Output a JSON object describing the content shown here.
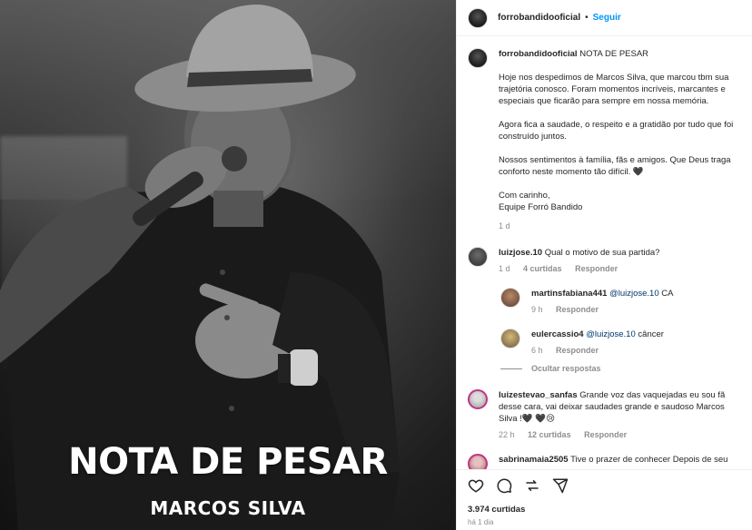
{
  "media": {
    "overlay_title": "NOTA DE PESAR",
    "overlay_subtitle": "MARCOS SILVA"
  },
  "header": {
    "username": "forrobandidooficial",
    "separator": "•",
    "follow_label": "Seguir"
  },
  "caption": {
    "username": "forrobandidooficial",
    "headline": "NOTA DE PESAR",
    "paragraphs": [
      "Hoje nos despedimos de Marcos Silva, que marcou tbm sua trajetória conosco. Foram momentos incríveis, marcantes e especiais que ficarão para sempre em nossa memória.",
      "Agora fica a saudade, o respeito e a gratidão por tudo que foi construído juntos.",
      "Nossos sentimentos à família, fãs e amigos. Que Deus traga conforto neste momento tão difícil. 🖤"
    ],
    "sign_line1": "Com carinho,",
    "sign_line2": "Equipe Forró Bandido",
    "time": "1 d"
  },
  "comments": [
    {
      "username": "luizjose.10",
      "text": "Qual o motivo de sua partida?",
      "time": "1 d",
      "likes": "4 curtidas",
      "reply_label": "Responder",
      "replies": [
        {
          "username": "martinsfabiana441",
          "mention": "@luizjose.10",
          "text": "CA",
          "time": "9 h",
          "reply_label": "Responder"
        },
        {
          "username": "eulercassio4",
          "mention": "@luizjose.10",
          "text": "câncer",
          "time": "6 h",
          "reply_label": "Responder"
        }
      ],
      "hide_replies_label": "Ocultar respostas"
    },
    {
      "username": "luizestevao_sanfas",
      "text": "Grande voz das vaquejadas eu sou fã desse cara, vai deixar saudades grande e saudoso Marcos Silva !🖤 🖤😢",
      "time": "22 h",
      "likes": "12 curtidas",
      "reply_label": "Responder"
    },
    {
      "username": "sabrinamaia2505",
      "text": "Tive o prazer de conhecer Depois de seu"
    }
  ],
  "footer": {
    "likes": "3.974 curtidas",
    "posted": "há 1 dia"
  },
  "icons": [
    "heart-icon",
    "comment-icon",
    "share-icon",
    "send-icon"
  ]
}
